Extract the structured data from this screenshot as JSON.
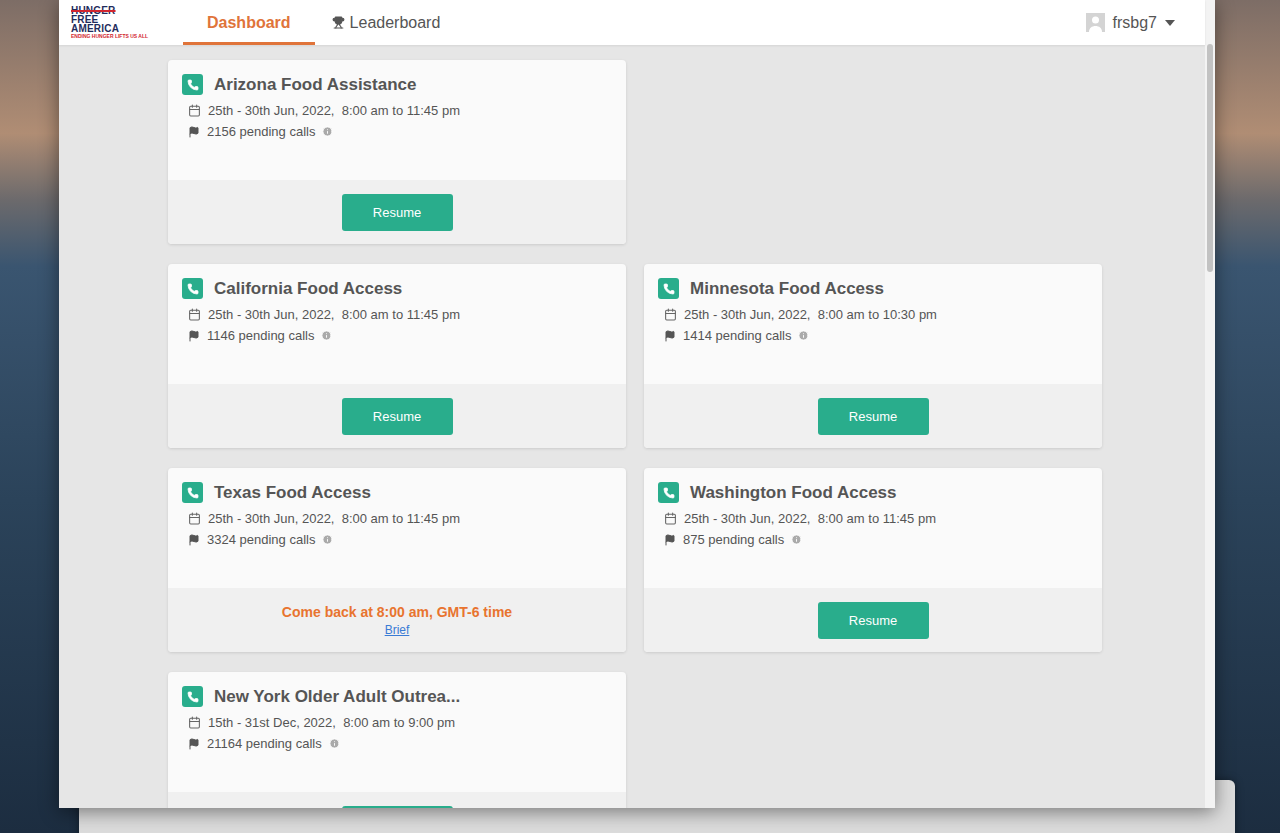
{
  "header": {
    "logo": {
      "lines": [
        "HUNGER",
        "FREE",
        "AMERICA"
      ],
      "tagline": "ENDING HUNGER LIFTS US ALL"
    },
    "tabs": [
      {
        "label": "Dashboard",
        "selected": true
      },
      {
        "label": "Leaderboard",
        "selected": false
      }
    ],
    "user": {
      "name": "frsbg7"
    }
  },
  "rows": [
    [
      {
        "title": "Arizona Food Assistance",
        "dates": "25th - 30th Jun, 2022,  8:00 am to 11:45 pm",
        "pending": "2156 pending calls",
        "action": {
          "kind": "button",
          "label": "Resume"
        }
      }
    ],
    [
      {
        "title": "California Food Access",
        "dates": "25th - 30th Jun, 2022,  8:00 am to 11:45 pm",
        "pending": "1146 pending calls",
        "action": {
          "kind": "button",
          "label": "Resume"
        }
      },
      {
        "title": "Minnesota Food Access",
        "dates": "25th - 30th Jun, 2022,  8:00 am to 10:30 pm",
        "pending": "1414 pending calls",
        "action": {
          "kind": "button",
          "label": "Resume"
        }
      }
    ],
    [
      {
        "title": "Texas Food Access",
        "dates": "25th - 30th Jun, 2022,  8:00 am to 11:45 pm",
        "pending": "3324 pending calls",
        "action": {
          "kind": "notice",
          "label": "Come back at 8:00 am, GMT-6 time",
          "link": "Brief"
        }
      },
      {
        "title": "Washington Food Access",
        "dates": "25th - 30th Jun, 2022,  8:00 am to 11:45 pm",
        "pending": "875 pending calls",
        "action": {
          "kind": "button",
          "label": "Resume"
        }
      }
    ],
    [
      {
        "title": "New York Older Adult Outrea...",
        "dates": "15th - 31st Dec, 2022,  8:00 am to 9:00 pm",
        "pending": "21164 pending calls",
        "action": {
          "kind": "button"
        }
      }
    ]
  ]
}
